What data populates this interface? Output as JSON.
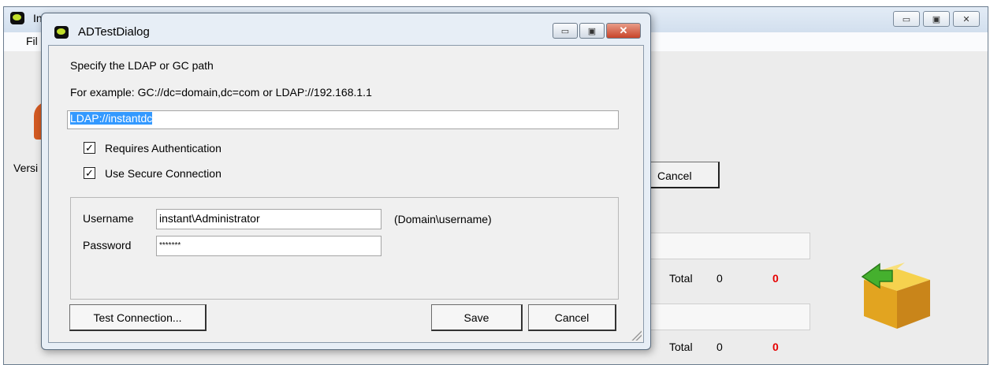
{
  "main_window": {
    "title_partial": "In",
    "menu_file_partial": "Fil",
    "version_partial": "Versi",
    "cancel_label": "Cancel",
    "total_label": "Total",
    "rows": [
      {
        "total_value": "0",
        "red_value": "0"
      },
      {
        "total_value": "0",
        "red_value": "0"
      }
    ]
  },
  "dialog": {
    "title": "ADTestDialog",
    "prompt": "Specify the LDAP or GC path",
    "example": "For example: GC://dc=domain,dc=com or LDAP://192.168.1.1",
    "path_value": "LDAP://instantdc",
    "requires_auth_label": "Requires Authentication",
    "requires_auth_checked": true,
    "secure_conn_label": "Use Secure Connection",
    "secure_conn_checked": true,
    "username_label": "Username",
    "username_value": "instant\\Administrator",
    "username_hint": "(Domain\\username)",
    "password_label": "Password",
    "password_value": "*******",
    "test_button": "Test Connection...",
    "save_button": "Save",
    "cancel_button": "Cancel"
  },
  "colors": {
    "accent_selection": "#3399ff",
    "red_count": "#e60000"
  }
}
